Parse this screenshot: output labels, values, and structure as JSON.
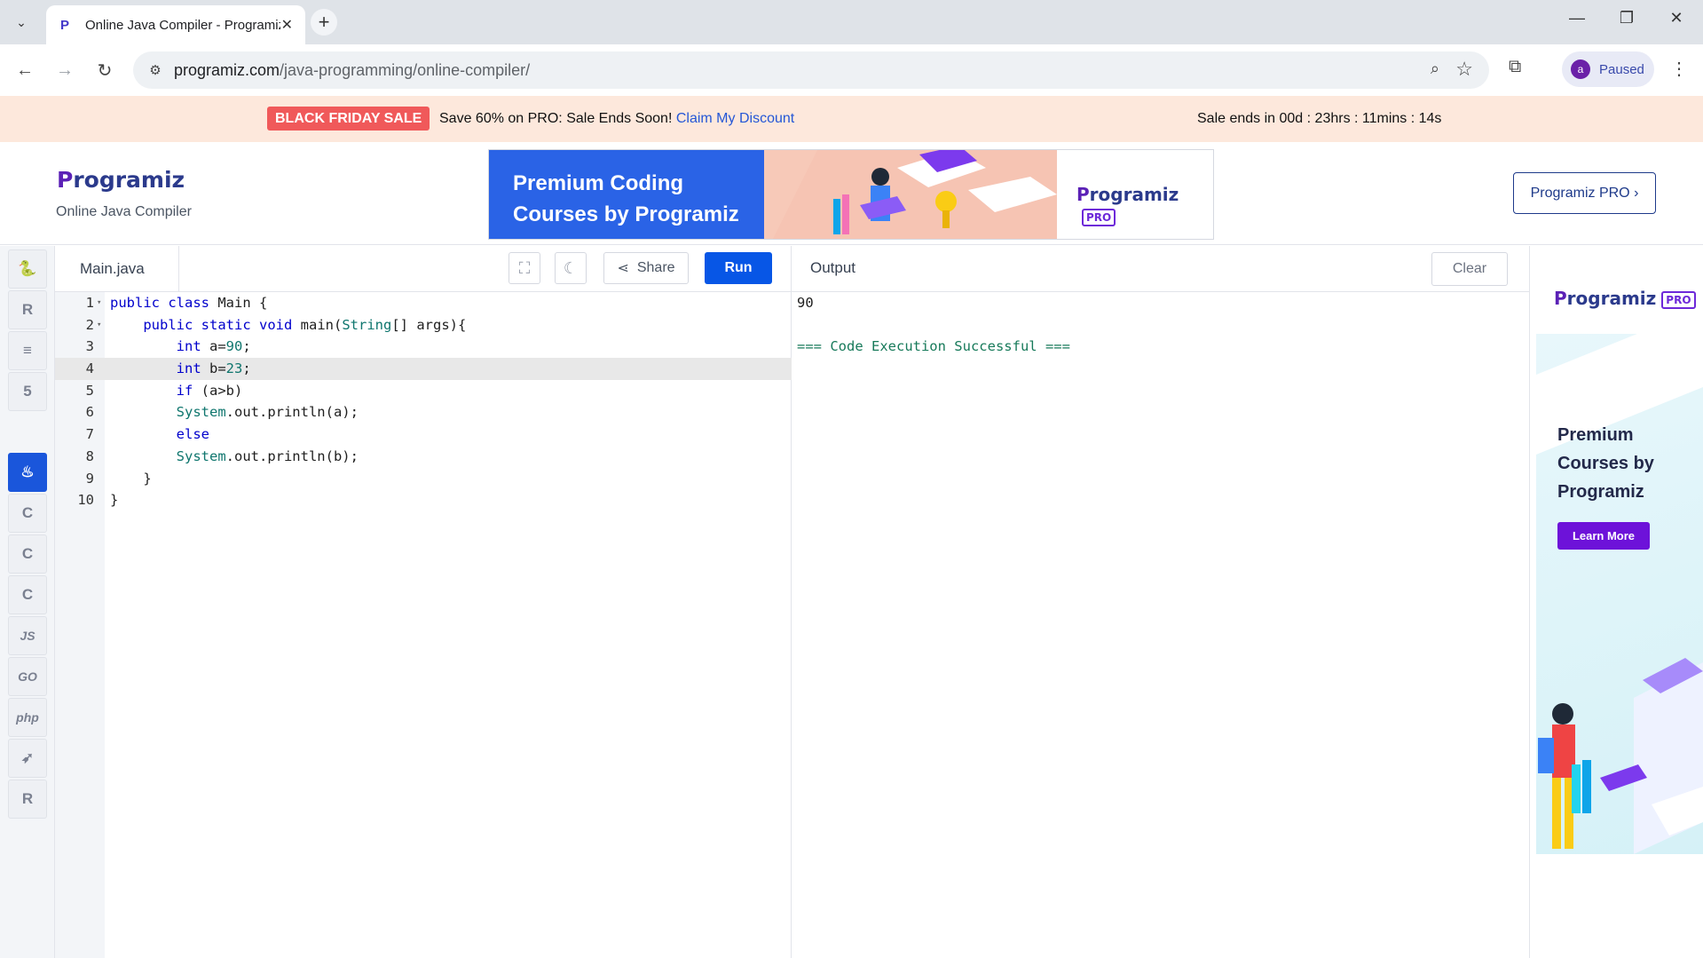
{
  "browser": {
    "tab_title": "Online Java Compiler - Programiz",
    "url_domain": "programiz.com",
    "url_path": "/java-programming/online-compiler/",
    "profile_initial": "a",
    "profile_status": "Paused"
  },
  "promo": {
    "badge": "BLACK FRIDAY SALE",
    "text": "Save 60% on PRO: Sale Ends Soon!",
    "link": "Claim My Discount",
    "countdown": "Sale ends in 00d : 23hrs : 11mins : 14s"
  },
  "header": {
    "logo": "rogramiz",
    "logo_p": "P",
    "subtitle": "Online Java Compiler",
    "banner_text": "Premium Coding Courses by Programiz",
    "banner_logo": "rogramiz",
    "banner_logo_p": "P",
    "banner_pro": "PRO",
    "pro_button": "Programiz PRO ›"
  },
  "languages": [
    {
      "name": "python",
      "glyph": "🐍"
    },
    {
      "name": "r",
      "glyph": "R"
    },
    {
      "name": "sql",
      "glyph": "≡"
    },
    {
      "name": "html",
      "glyph": "5"
    },
    {
      "name": "java",
      "glyph": "♨"
    },
    {
      "name": "c",
      "glyph": "C"
    },
    {
      "name": "cpp",
      "glyph": "C"
    },
    {
      "name": "csharp",
      "glyph": "C"
    },
    {
      "name": "js",
      "glyph": "JS"
    },
    {
      "name": "go",
      "glyph": "GO"
    },
    {
      "name": "php",
      "glyph": "php"
    },
    {
      "name": "swift",
      "glyph": "➶"
    },
    {
      "name": "rust",
      "glyph": "R"
    }
  ],
  "editor": {
    "filename": "Main.java",
    "share_label": "Share",
    "run_label": "Run",
    "code": [
      "public class Main {",
      "    public static void main(String[] args){",
      "        int a=90;",
      "        int b=23;",
      "        if (a>b)",
      "        System.out.println(a);",
      "        else",
      "        System.out.println(b);",
      "    }",
      "}"
    ]
  },
  "output": {
    "title": "Output",
    "clear_label": "Clear",
    "result": "90",
    "status": "=== Code Execution Successful ==="
  },
  "side_ad": {
    "logo": "rogramiz",
    "logo_p": "P",
    "pro": "PRO",
    "headline": "Premium Courses by Programiz",
    "cta": "Learn More"
  }
}
